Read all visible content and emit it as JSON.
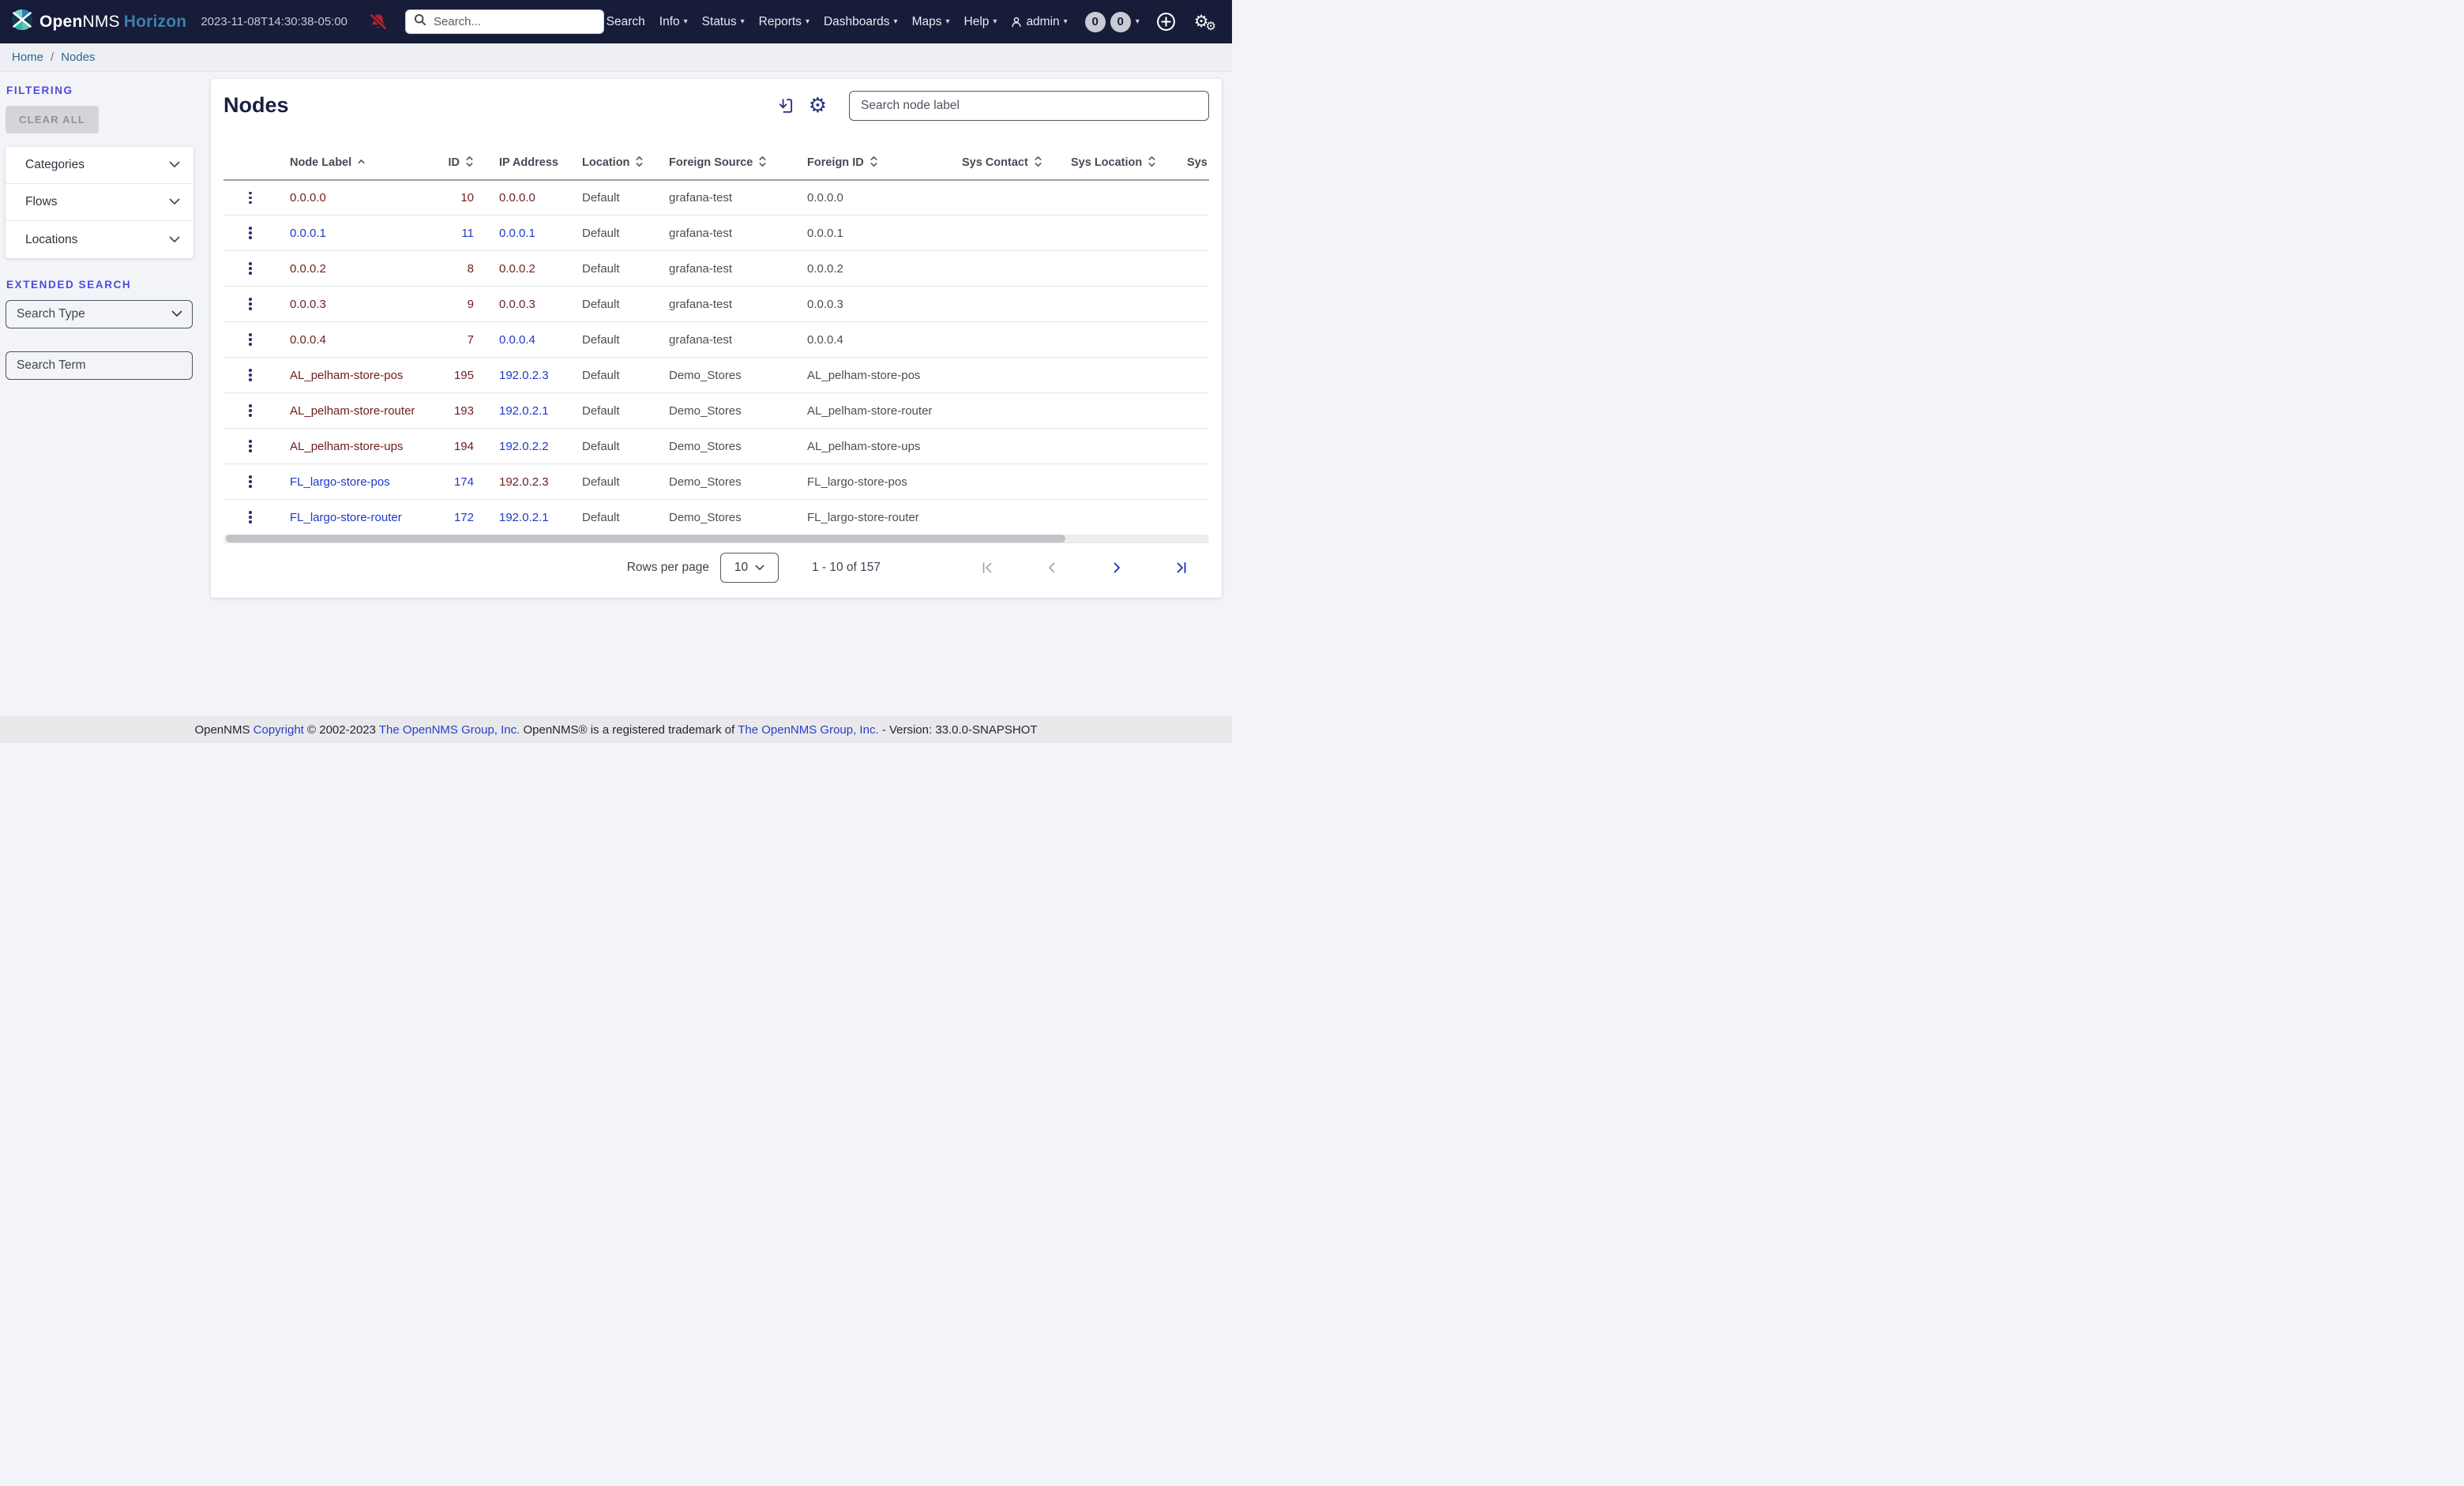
{
  "colors": {
    "navbar_bg": "#171c38",
    "brand_product": "#3d7fae",
    "bell_red": "#b5242f",
    "heading_indigo": "#4b4be0",
    "link_blue": "#2038c8",
    "link_visited": "#6e1d1d",
    "icon_navy": "#273180",
    "pager_active": "#2233b5",
    "pager_disabled": "#a6a9af"
  },
  "navbar": {
    "brand": {
      "open": "Open",
      "nms": "NMS",
      "product": "Horizon"
    },
    "timestamp": "2023-11-08T14:30:38-05:00",
    "search_placeholder": "Search...",
    "menu": [
      {
        "label": "Search",
        "caret": false
      },
      {
        "label": "Info",
        "caret": true
      },
      {
        "label": "Status",
        "caret": true
      },
      {
        "label": "Reports",
        "caret": true
      },
      {
        "label": "Dashboards",
        "caret": true
      },
      {
        "label": "Maps",
        "caret": true
      },
      {
        "label": "Help",
        "caret": true
      },
      {
        "label": "admin",
        "caret": true,
        "user": true
      }
    ],
    "badges": [
      "0",
      "0"
    ]
  },
  "breadcrumb": {
    "items": [
      "Home",
      "Nodes"
    ],
    "separator": "/"
  },
  "sidebar": {
    "filtering_heading": "FILTERING",
    "clear_all": "CLEAR ALL",
    "accordions": [
      "Categories",
      "Flows",
      "Locations"
    ],
    "extended_heading": "EXTENDED SEARCH",
    "search_type_label": "Search Type",
    "search_term_placeholder": "Search Term"
  },
  "main": {
    "title": "Nodes",
    "node_search_placeholder": "Search node label",
    "columns": [
      {
        "label": "Node Label",
        "sort": "asc"
      },
      {
        "label": "ID",
        "sort": "both",
        "numeric": true
      },
      {
        "label": "IP Address",
        "sort": "none"
      },
      {
        "label": "Location",
        "sort": "both"
      },
      {
        "label": "Foreign Source",
        "sort": "both"
      },
      {
        "label": "Foreign ID",
        "sort": "both"
      },
      {
        "label": "Sys Contact",
        "sort": "both"
      },
      {
        "label": "Sys Location",
        "sort": "both"
      },
      {
        "label": "Sys Description",
        "sort": "both"
      }
    ],
    "rows": [
      {
        "label": "0.0.0.0",
        "label_color": "visited",
        "id": "10",
        "id_color": "visited",
        "ip": "0.0.0.0",
        "ip_color": "visited",
        "location": "Default",
        "foreign_source": "grafana-test",
        "foreign_id": "0.0.0.0",
        "sys_contact": "",
        "sys_location": "",
        "sys_description": ""
      },
      {
        "label": "0.0.0.1",
        "label_color": "link",
        "id": "11",
        "id_color": "link",
        "ip": "0.0.0.1",
        "ip_color": "link",
        "location": "Default",
        "foreign_source": "grafana-test",
        "foreign_id": "0.0.0.1",
        "sys_contact": "",
        "sys_location": "",
        "sys_description": ""
      },
      {
        "label": "0.0.0.2",
        "label_color": "visited",
        "id": "8",
        "id_color": "visited",
        "ip": "0.0.0.2",
        "ip_color": "visited",
        "location": "Default",
        "foreign_source": "grafana-test",
        "foreign_id": "0.0.0.2",
        "sys_contact": "",
        "sys_location": "",
        "sys_description": ""
      },
      {
        "label": "0.0.0.3",
        "label_color": "visited",
        "id": "9",
        "id_color": "visited",
        "ip": "0.0.0.3",
        "ip_color": "visited",
        "location": "Default",
        "foreign_source": "grafana-test",
        "foreign_id": "0.0.0.3",
        "sys_contact": "",
        "sys_location": "",
        "sys_description": ""
      },
      {
        "label": "0.0.0.4",
        "label_color": "visited",
        "id": "7",
        "id_color": "visited",
        "ip": "0.0.0.4",
        "ip_color": "link",
        "location": "Default",
        "foreign_source": "grafana-test",
        "foreign_id": "0.0.0.4",
        "sys_contact": "",
        "sys_location": "",
        "sys_description": ""
      },
      {
        "label": "AL_pelham-store-pos",
        "label_color": "visited",
        "id": "195",
        "id_color": "visited",
        "ip": "192.0.2.3",
        "ip_color": "link",
        "location": "Default",
        "foreign_source": "Demo_Stores",
        "foreign_id": "AL_pelham-store-pos",
        "sys_contact": "",
        "sys_location": "",
        "sys_description": ""
      },
      {
        "label": "AL_pelham-store-router",
        "label_color": "visited",
        "id": "193",
        "id_color": "visited",
        "ip": "192.0.2.1",
        "ip_color": "link",
        "location": "Default",
        "foreign_source": "Demo_Stores",
        "foreign_id": "AL_pelham-store-router",
        "sys_contact": "",
        "sys_location": "",
        "sys_description": ""
      },
      {
        "label": "AL_pelham-store-ups",
        "label_color": "visited",
        "id": "194",
        "id_color": "visited",
        "ip": "192.0.2.2",
        "ip_color": "link",
        "location": "Default",
        "foreign_source": "Demo_Stores",
        "foreign_id": "AL_pelham-store-ups",
        "sys_contact": "",
        "sys_location": "",
        "sys_description": ""
      },
      {
        "label": "FL_largo-store-pos",
        "label_color": "link",
        "id": "174",
        "id_color": "link",
        "ip": "192.0.2.3",
        "ip_color": "visited",
        "location": "Default",
        "foreign_source": "Demo_Stores",
        "foreign_id": "FL_largo-store-pos",
        "sys_contact": "",
        "sys_location": "",
        "sys_description": ""
      },
      {
        "label": "FL_largo-store-router",
        "label_color": "link",
        "id": "172",
        "id_color": "link",
        "ip": "192.0.2.1",
        "ip_color": "link",
        "location": "Default",
        "foreign_source": "Demo_Stores",
        "foreign_id": "FL_largo-store-router",
        "sys_contact": "",
        "sys_location": "",
        "sys_description": ""
      }
    ],
    "pagination": {
      "rows_per_page_label": "Rows per page",
      "rows_per_page_value": "10",
      "range_text": "1 - 10 of 157"
    }
  },
  "footer": {
    "segments": [
      {
        "text": "OpenNMS ",
        "link": false
      },
      {
        "text": "Copyright",
        "link": true
      },
      {
        "text": " © 2002-2023 ",
        "link": false
      },
      {
        "text": "The OpenNMS Group, Inc.",
        "link": true
      },
      {
        "text": " OpenNMS® is a registered trademark of ",
        "link": false
      },
      {
        "text": "The OpenNMS Group, Inc.",
        "link": true
      },
      {
        "text": " - Version: 33.0.0-SNAPSHOT",
        "link": false
      }
    ]
  }
}
